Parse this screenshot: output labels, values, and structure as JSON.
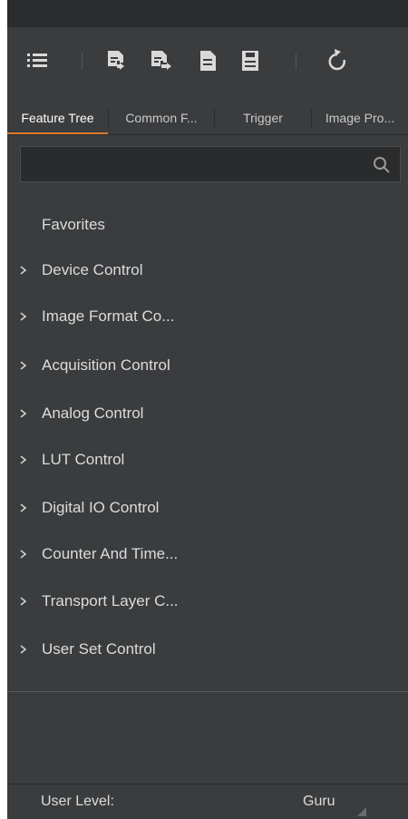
{
  "toolbar": {
    "icons": [
      "list-indent-icon",
      "import-features-icon",
      "export-features-icon",
      "document-icon",
      "save-icon",
      "refresh-icon"
    ]
  },
  "tabs": [
    {
      "label": "Feature Tree",
      "active": true
    },
    {
      "label": "Common F...",
      "active": false
    },
    {
      "label": "Trigger",
      "active": false
    },
    {
      "label": "Image Pro...",
      "active": false
    }
  ],
  "search": {
    "value": "",
    "placeholder": ""
  },
  "tree": {
    "items": [
      {
        "label": "Favorites",
        "expandable": false
      },
      {
        "label": "Device Control",
        "expandable": true
      },
      {
        "label": "Image Format Co...",
        "expandable": true
      },
      {
        "label": "Acquisition Control",
        "expandable": true
      },
      {
        "label": "Analog Control",
        "expandable": true
      },
      {
        "label": "LUT Control",
        "expandable": true
      },
      {
        "label": "Digital IO Control",
        "expandable": true
      },
      {
        "label": "Counter And Time...",
        "expandable": true
      },
      {
        "label": "Transport Layer C...",
        "expandable": true
      },
      {
        "label": "User Set Control",
        "expandable": true
      }
    ]
  },
  "status": {
    "user_level_label": "User Level:",
    "user_level_value": "Guru"
  },
  "colors": {
    "accent": "#e07b2b",
    "panel_bg": "#3a3c3e",
    "text": "#dcdcdc"
  }
}
